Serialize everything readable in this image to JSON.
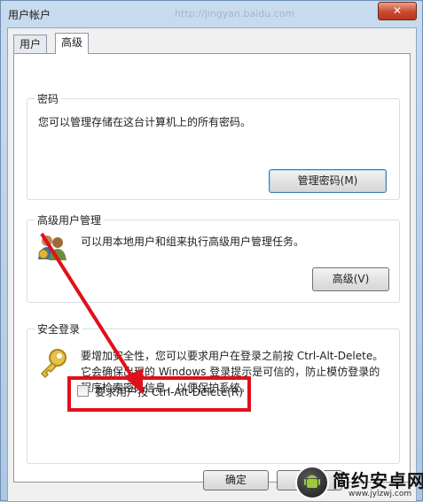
{
  "window": {
    "title": "用户帐户",
    "url_watermark": "http://jingyan.baidu.com",
    "close_label": "✕"
  },
  "tabs": [
    {
      "label": "用户",
      "active": false
    },
    {
      "label": "高级",
      "active": true
    }
  ],
  "passwords": {
    "legend": "密码",
    "description": "您可以管理存储在这台计算机上的所有密码。",
    "button": "管理密码(M)"
  },
  "advanced_user": {
    "legend": "高级用户管理",
    "description": "可以用本地用户和组来执行高级用户管理任务。",
    "button": "高级(V)",
    "icon": "users-icon"
  },
  "secure_logon": {
    "legend": "安全登录",
    "line1": "要增加安全性，您可以要求用户在登录之前按 Ctrl-Alt-Delete。",
    "line2": "它会确保出现的 Windows 登录提示是可信的，防止模仿登录的",
    "line3": "程序检索密码信息，以便保护系统。",
    "checkbox_label": "要求用户按 Ctrl-Alt-Delete(R)",
    "checkbox_checked": false,
    "icon": "key-icon"
  },
  "footer": {
    "ok": "确定",
    "cancel": "取"
  },
  "annotation": {
    "color": "#e0101a"
  },
  "logo": {
    "text": "简约安卓网",
    "sub": "www.jylzwj.com"
  }
}
